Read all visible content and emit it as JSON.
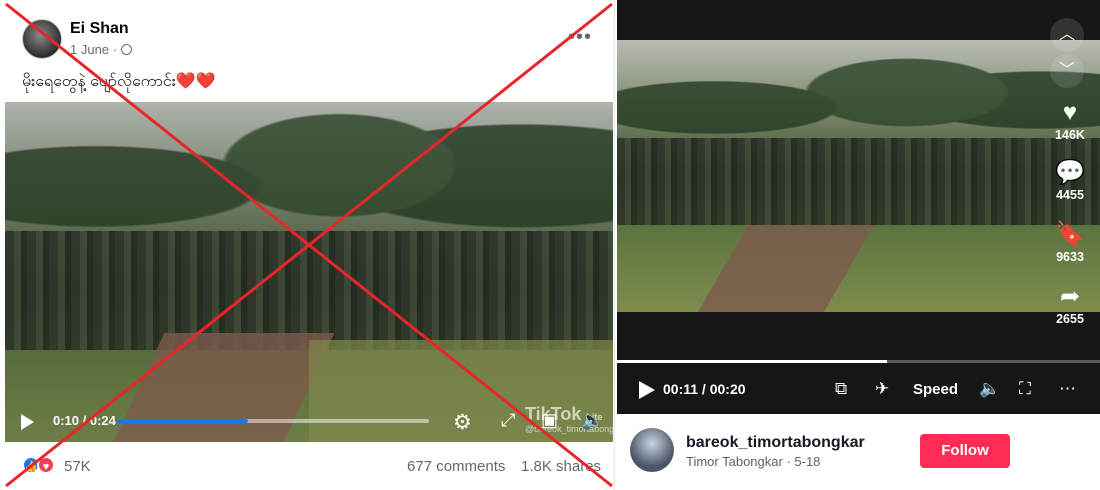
{
  "facebook": {
    "author_name": "Ei Shan",
    "post_date": "1 June · ",
    "caption": "မိုးရေတွေနဲ့ ပျော်လိုကောင်း",
    "caption_emoji": "❤️❤️",
    "more_icon": "•••",
    "video": {
      "current_time": "0:10",
      "duration": "0:24",
      "time_separator": " / ",
      "progress": 0.42,
      "watermark_text": "TikTok",
      "watermark_handle": "@bareok_timortabongkar",
      "watermark_lite": "Lite"
    },
    "reactions_count": "57K",
    "comments": "677 comments",
    "shares": "1.8K shares"
  },
  "tiktok": {
    "likes": "146K",
    "comments": "4455",
    "saves": "9633",
    "shares": "2655",
    "current_time": "00:11",
    "duration": "00:20",
    "time_separator": " / ",
    "progress": 0.56,
    "speed_label": "Speed",
    "username": "bareok_timortabongkar",
    "display_name": "Timor Tabongkar",
    "date": "5-18",
    "sub_separator": " · ",
    "follow_label": "Follow"
  },
  "colors": {
    "fb_blue": "#1877f2",
    "fb_love": "#f33e58",
    "tiktok_red": "#fe2c55",
    "x_mark": "#e8262a"
  }
}
